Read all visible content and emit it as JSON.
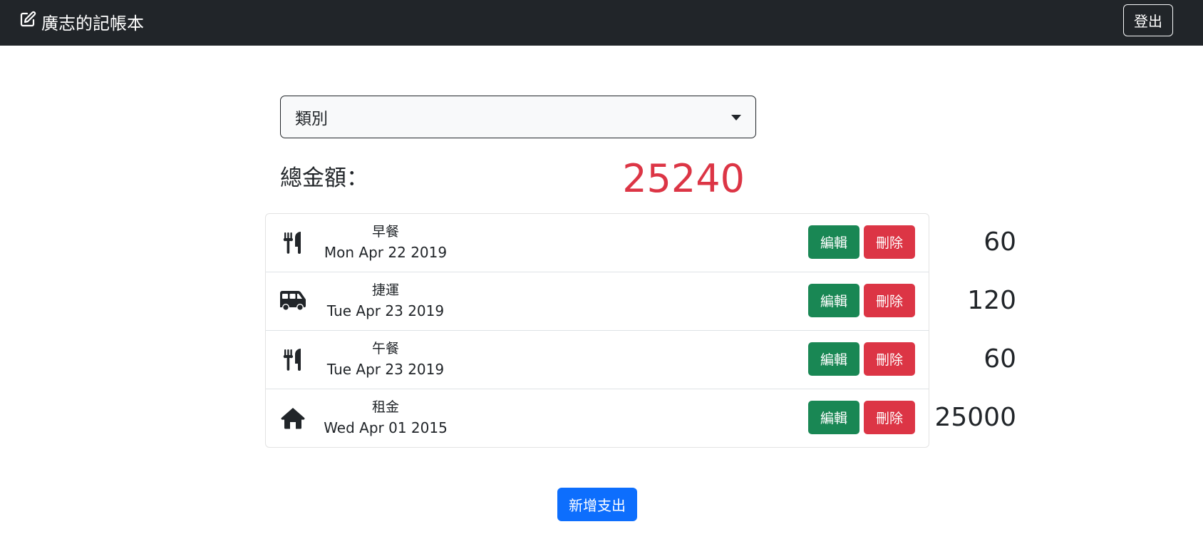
{
  "navbar": {
    "brand_title": "廣志的記帳本",
    "brand_icon": "edit-icon",
    "logout_label": "登出"
  },
  "filter": {
    "category_selected": "類別"
  },
  "summary": {
    "total_label": "總金額：",
    "total_value": "25240",
    "total_color": "#dc3545"
  },
  "expenses": [
    {
      "icon": "utensils-icon",
      "name": "早餐",
      "date": "Mon Apr 22 2019",
      "amount": "60"
    },
    {
      "icon": "shuttle-van-icon",
      "name": "捷運",
      "date": "Tue Apr 23 2019",
      "amount": "120"
    },
    {
      "icon": "utensils-icon",
      "name": "午餐",
      "date": "Tue Apr 23 2019",
      "amount": "60"
    },
    {
      "icon": "home-icon",
      "name": "租金",
      "date": "Wed Apr 01 2015",
      "amount": "25000"
    }
  ],
  "row_actions": {
    "edit_label": "編輯",
    "delete_label": "刪除"
  },
  "add_expense_label": "新增支出",
  "colors": {
    "navbar_bg": "#212529",
    "edit_green": "#198754",
    "delete_red": "#dc3545",
    "primary_blue": "#0d6efd"
  }
}
